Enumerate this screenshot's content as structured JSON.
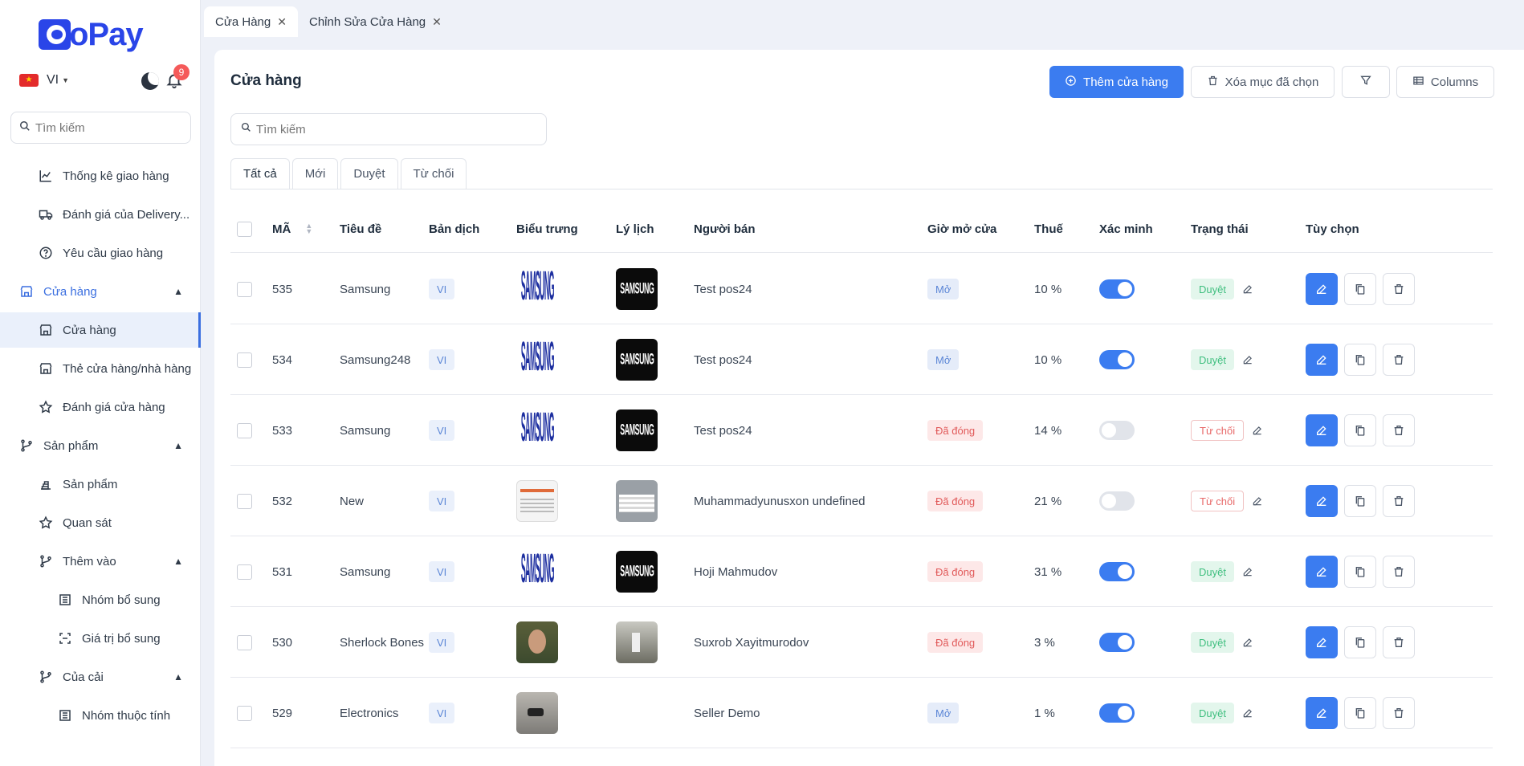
{
  "app": {
    "logo_text": "oPay"
  },
  "topbar": {
    "language": "VI",
    "notification_count": "9"
  },
  "sidebar": {
    "search_placeholder": "Tìm kiếm",
    "items": [
      {
        "label": "Thống kê giao hàng"
      },
      {
        "label": "Đánh giá của Delivery..."
      },
      {
        "label": "Yêu cầu giao hàng"
      },
      {
        "label": "Cửa hàng"
      },
      {
        "label": "Cửa hàng"
      },
      {
        "label": "Thẻ cửa hàng/nhà hàng"
      },
      {
        "label": "Đánh giá cửa hàng"
      },
      {
        "label": "Sản phẩm"
      },
      {
        "label": "Sản phẩm"
      },
      {
        "label": "Quan sát"
      },
      {
        "label": "Thêm vào"
      },
      {
        "label": "Nhóm bổ sung"
      },
      {
        "label": "Giá trị bổ sung"
      },
      {
        "label": "Của cải"
      },
      {
        "label": "Nhóm thuộc tính"
      }
    ]
  },
  "tabs": [
    {
      "label": "Cửa Hàng"
    },
    {
      "label": "Chỉnh Sửa Cửa Hàng"
    }
  ],
  "page": {
    "title": "Cửa hàng",
    "add_button": "Thêm cửa hàng",
    "delete_selected_button": "Xóa mục đã chọn",
    "columns_button": "Columns",
    "search_placeholder": "Tìm kiếm"
  },
  "filter_tabs": [
    {
      "label": "Tất cả"
    },
    {
      "label": "Mới"
    },
    {
      "label": "Duyệt"
    },
    {
      "label": "Từ chối"
    }
  ],
  "table": {
    "headers": [
      "MÃ",
      "Tiêu đề",
      "Bản dịch",
      "Biểu trưng",
      "Lý lịch",
      "Người bán",
      "Giờ mở cửa",
      "Thuế",
      "Xác minh",
      "Trạng thái",
      "Tùy chọn"
    ],
    "rows": [
      {
        "id": "535",
        "title": "Samsung",
        "translation": "VI",
        "logo": "samsung-logo",
        "background": "samsung-dark",
        "seller": "Test pos24",
        "hours": "Mở",
        "hours_state": "open",
        "tax": "10 %",
        "verified": true,
        "status": "Duyệt",
        "status_state": "ok"
      },
      {
        "id": "534",
        "title": "Samsung248",
        "translation": "VI",
        "logo": "samsung-logo",
        "background": "samsung-dark",
        "seller": "Test pos24",
        "hours": "Mở",
        "hours_state": "open",
        "tax": "10 %",
        "verified": true,
        "status": "Duyệt",
        "status_state": "ok"
      },
      {
        "id": "533",
        "title": "Samsung",
        "translation": "VI",
        "logo": "samsung-logo",
        "background": "samsung-dark",
        "seller": "Test pos24",
        "hours": "Đã đóng",
        "hours_state": "closed",
        "tax": "14 %",
        "verified": false,
        "status": "Từ chối",
        "status_state": "no"
      },
      {
        "id": "532",
        "title": "New",
        "translation": "VI",
        "logo": "doc",
        "background": "doc2",
        "seller": "Muhammadyunusxon undefined",
        "hours": "Đã đóng",
        "hours_state": "closed",
        "tax": "21 %",
        "verified": false,
        "status": "Từ chối",
        "status_state": "no"
      },
      {
        "id": "531",
        "title": "Samsung",
        "translation": "VI",
        "logo": "samsung-logo",
        "background": "samsung-dark",
        "seller": "Hoji Mahmudov",
        "hours": "Đã đóng",
        "hours_state": "closed",
        "tax": "31 %",
        "verified": true,
        "status": "Duyệt",
        "status_state": "ok"
      },
      {
        "id": "530",
        "title": "Sherlock Bones",
        "translation": "VI",
        "logo": "face",
        "background": "scene",
        "seller": "Suxrob Xayitmurodov",
        "hours": "Đã đóng",
        "hours_state": "closed",
        "tax": "3 %",
        "verified": true,
        "status": "Duyệt",
        "status_state": "ok"
      },
      {
        "id": "529",
        "title": "Electronics",
        "translation": "VI",
        "logo": "desk",
        "background": "sketch",
        "seller": "Seller Demo",
        "hours": "Mở",
        "hours_state": "open",
        "tax": "1 %",
        "verified": true,
        "status": "Duyệt",
        "status_state": "ok"
      }
    ]
  },
  "images": {
    "samsung_text": "SAMSUNG"
  },
  "colors": {
    "accent": "#3b7cf0",
    "brand": "#2a45e8",
    "danger": "#e15a5a",
    "success": "#3fbf7f"
  }
}
